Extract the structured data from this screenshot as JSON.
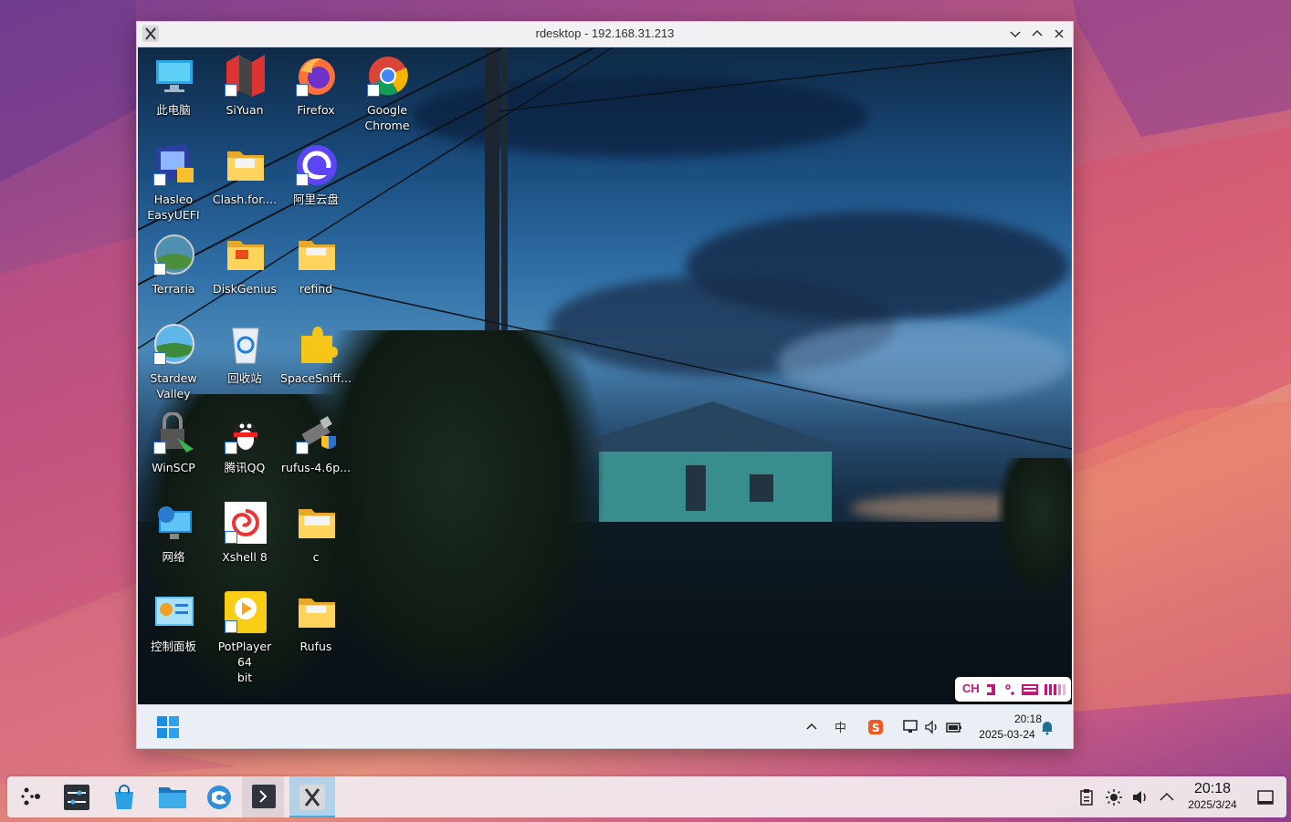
{
  "window": {
    "title": "rdesktop - 192.168.31.213",
    "buttons": [
      "minimize",
      "maximize",
      "close"
    ]
  },
  "desktop_icons": [
    {
      "label": "此电脑",
      "icon": "computer-icon"
    },
    {
      "label": "SiYuan",
      "icon": "siyuan-icon"
    },
    {
      "label": "Firefox",
      "icon": "firefox-icon"
    },
    {
      "label": "Google\nChrome",
      "icon": "chrome-icon"
    },
    {
      "label": "Hasleo\nEasyUEFI",
      "icon": "easyuefi-icon"
    },
    {
      "label": "Clash.for....",
      "icon": "folder-icon"
    },
    {
      "label": "阿里云盘",
      "icon": "aliyun-drive-icon"
    },
    {
      "label": "Terraria",
      "icon": "terraria-icon"
    },
    {
      "label": "DiskGenius",
      "icon": "diskgenius-folder-icon"
    },
    {
      "label": "refind",
      "icon": "folder-icon"
    },
    {
      "label": "Stardew\nValley",
      "icon": "stardew-valley-icon"
    },
    {
      "label": "回收站",
      "icon": "recycle-bin-icon"
    },
    {
      "label": "SpaceSniff...",
      "icon": "spacesniffer-icon"
    },
    {
      "label": "WinSCP",
      "icon": "winscp-icon"
    },
    {
      "label": "腾讯QQ",
      "icon": "qq-icon"
    },
    {
      "label": "rufus-4.6p...",
      "icon": "rufus-usb-icon"
    },
    {
      "label": "网络",
      "icon": "network-icon"
    },
    {
      "label": "Xshell 8",
      "icon": "xshell-icon"
    },
    {
      "label": "c",
      "icon": "folder-icon"
    },
    {
      "label": "控制面板",
      "icon": "control-panel-icon"
    },
    {
      "label": "PotPlayer 64\nbit",
      "icon": "potplayer-icon"
    },
    {
      "label": "Rufus",
      "icon": "folder-icon"
    }
  ],
  "ime_bar": {
    "lang": "CH",
    "items": [
      "mode-icon",
      "punctuation-icon",
      "keyboard-icon",
      "settings-icon"
    ]
  },
  "remote_taskbar": {
    "start": "windows-start-icon",
    "tray": [
      "show-hidden-icon",
      "input-method-icon",
      "sogou-icon",
      "network-icon",
      "volume-icon",
      "battery-icon"
    ],
    "time": "20:18",
    "date": "2025-03-24",
    "notification": "bell-icon"
  },
  "host_panel": {
    "launchers": [
      {
        "name": "application-launcher",
        "icon": "kde-launcher-icon"
      },
      {
        "name": "system-settings",
        "icon": "settings-sliders-icon"
      },
      {
        "name": "discover",
        "icon": "store-bag-icon"
      },
      {
        "name": "file-manager",
        "icon": "folder-icon"
      },
      {
        "name": "browser",
        "icon": "browser-icon"
      },
      {
        "name": "terminal",
        "icon": "terminal-icon"
      },
      {
        "name": "rdesktop",
        "icon": "x-window-icon"
      }
    ],
    "tray": [
      "clipboard-icon",
      "brightness-icon",
      "volume-icon",
      "chevron-up-icon"
    ],
    "time": "20:18",
    "date": "2025/3/24",
    "show_desktop": "show-desktop-icon"
  }
}
